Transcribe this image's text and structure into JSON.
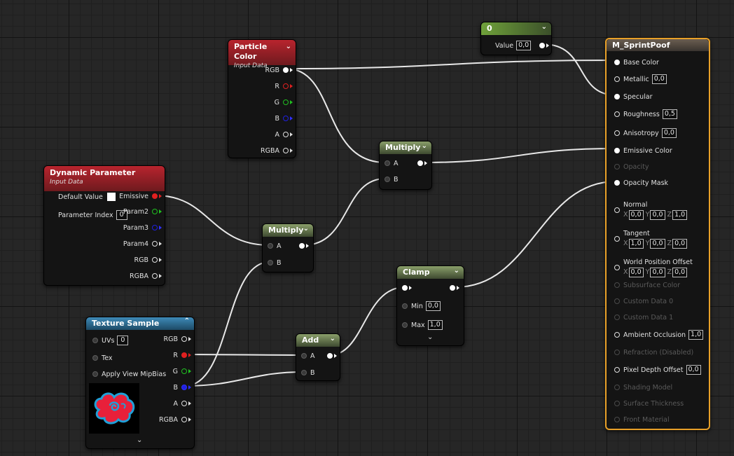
{
  "particle_color": {
    "title": "Particle Color",
    "subtitle": "Input Data",
    "outputs": [
      "RGB",
      "R",
      "G",
      "B",
      "A",
      "RGBA"
    ]
  },
  "constant": {
    "title": "0",
    "value_label": "Value",
    "value": "0,0"
  },
  "dynamic_param": {
    "title": "Dynamic Parameter",
    "subtitle": "Input Data",
    "default_value_label": "Default Value",
    "parameter_index_label": "Parameter Index",
    "parameter_index": "0",
    "outputs": [
      "Emissive",
      "Param2",
      "Param3",
      "Param4",
      "RGB",
      "RGBA"
    ]
  },
  "multiply1": {
    "title": "Multiply",
    "in_a": "A",
    "in_b": "B"
  },
  "multiply2": {
    "title": "Multiply",
    "in_a": "A",
    "in_b": "B"
  },
  "clamp": {
    "title": "Clamp",
    "min_label": "Min",
    "min": "0,0",
    "max_label": "Max",
    "max": "1,0"
  },
  "add": {
    "title": "Add",
    "in_a": "A",
    "in_b": "B"
  },
  "texture_sample": {
    "title": "Texture Sample",
    "inputs": [
      "UVs",
      "Tex",
      "Apply View MipBias"
    ],
    "uvs_value": "0",
    "outputs": [
      "RGB",
      "R",
      "G",
      "B",
      "A",
      "RGBA"
    ],
    "preview_colors": {
      "fill": "#e8203a",
      "outline": "#20a0d8"
    }
  },
  "material": {
    "title": "M_SprintPoof",
    "base_color": "Base Color",
    "metallic": "Metallic",
    "metallic_value": "0,0",
    "specular": "Specular",
    "roughness": "Roughness",
    "roughness_value": "0,5",
    "anisotropy": "Anisotropy",
    "anisotropy_value": "0,0",
    "emissive": "Emissive Color",
    "opacity": "Opacity",
    "opacity_mask": "Opacity Mask",
    "normal": "Normal",
    "normal_x": "0,0",
    "normal_y": "0,0",
    "normal_z": "1,0",
    "tangent": "Tangent",
    "tangent_x": "1,0",
    "tangent_y": "0,0",
    "tangent_z": "0,0",
    "wpo": "World Position Offset",
    "wpo_x": "0,0",
    "wpo_y": "0,0",
    "wpo_z": "0,0",
    "axis_x": "X",
    "axis_y": "Y",
    "axis_z": "Z",
    "subsurface": "Subsurface Color",
    "custom0": "Custom Data 0",
    "custom1": "Custom Data 1",
    "ao": "Ambient Occlusion",
    "ao_value": "1,0",
    "refraction": "Refraction (Disabled)",
    "pdo": "Pixel Depth Offset",
    "pdo_value": "0,0",
    "shading": "Shading Model",
    "thickness": "Surface Thickness",
    "front": "Front Material",
    "accent": "#e8a028"
  }
}
